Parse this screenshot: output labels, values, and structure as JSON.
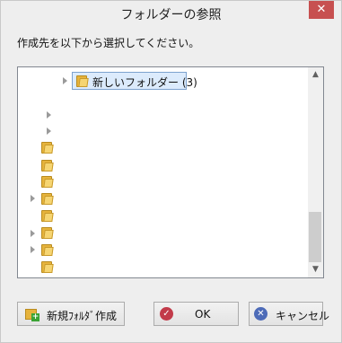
{
  "dialog": {
    "title": "フォルダーの参照",
    "close_label": "✕",
    "instruction": "作成先を以下から選択してください。"
  },
  "tree": {
    "selected_folder": "新しいフォルダー (3)"
  },
  "scrollbar": {
    "up_icon": "chevron-up",
    "down_icon": "chevron-down"
  },
  "buttons": {
    "new_folder": "新規ﾌｫﾙﾀﾞ作成",
    "ok": "OK",
    "cancel": "キャンセル"
  },
  "colors": {
    "close": "#c75050",
    "selection": "#dcebfc",
    "ok_icon": "#c23b4a",
    "cancel_icon": "#4d6bb8",
    "new_folder_plus": "#3aa335"
  }
}
